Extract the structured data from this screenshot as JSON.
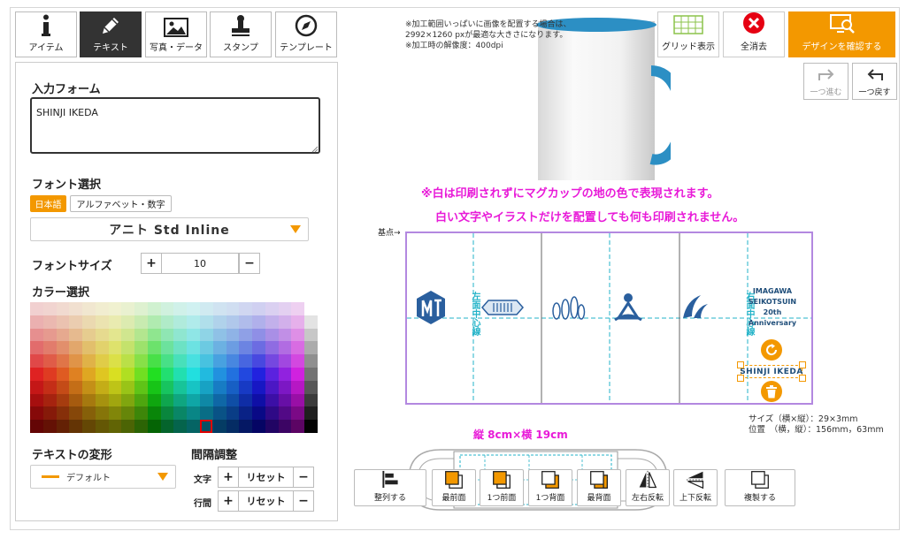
{
  "tabs": [
    {
      "label": "アイテム",
      "icon": "info-icon"
    },
    {
      "label": "テキスト",
      "icon": "pen-icon"
    },
    {
      "label": "写真・データ",
      "icon": "image-icon"
    },
    {
      "label": "スタンプ",
      "icon": "stamp-icon"
    },
    {
      "label": "テンプレート",
      "icon": "compass-icon"
    }
  ],
  "form": {
    "input_label": "入力フォーム",
    "input_value": "SHINJI IKEDA",
    "font_label": "フォント選択",
    "font_tabs": [
      "日本語",
      "アルファベット・数字"
    ],
    "font_value": "アニト Std Inline",
    "size_label": "フォントサイズ",
    "size_value": "10",
    "color_label": "カラー選択",
    "transform_label": "テキストの変形",
    "transform_value": "デフォルト",
    "spacing_label": "間隔調整",
    "char_label": "文字",
    "line_label": "行間",
    "reset_label": "リセット"
  },
  "toolbar": {
    "grid": "グリッド表示",
    "clear": "全消去",
    "confirm": "デザインを確認する",
    "redo": "一つ進む",
    "undo": "一つ戻す"
  },
  "notes": {
    "line1": "※加工範囲いっぱいに画像を配置する場合は、",
    "line2": "2992×1260 pxが最適な大きさになります。",
    "line3": "※加工時の解像度：400dpi"
  },
  "warning": {
    "line1": "※白は印刷されずにマグカップの地の色で表現されます。",
    "line2": "白い文字やイラストだけを配置しても何も印刷されません。"
  },
  "canvas": {
    "origin": "基点→",
    "center_left": "左面中心線",
    "center_right": "右面中心線",
    "emblem_lines": [
      "IMAGAWA",
      "SEIKOTSUIN",
      "20th",
      "Anniversary"
    ],
    "selected_text": "SHINJI IKEDA"
  },
  "info": {
    "size_line": "サイズ（横×縦）：29×3mm",
    "pos_line": "位置　（横，縦）：156mm，63mm"
  },
  "dimension": "縦 8cm×横 19cm",
  "bottom": [
    "整列する",
    "最前面",
    "1つ前面",
    "1つ背面",
    "最背面",
    "左右反転",
    "上下反転",
    "複製する"
  ],
  "colors": {
    "accent": "#f39800",
    "warning": "#e81ad8",
    "guide": "#23b3c8",
    "canvas_border": "#b388e0",
    "mug_blue": "#2c8fc4",
    "logo_blue": "#2a5f9e"
  }
}
